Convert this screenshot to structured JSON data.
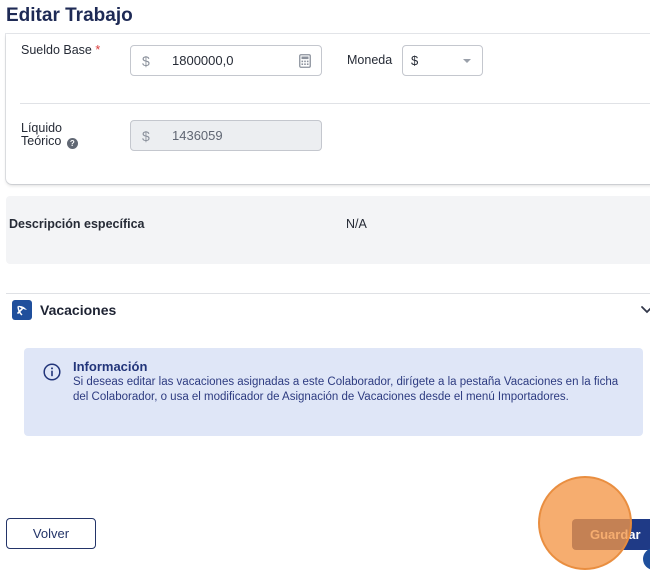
{
  "page": {
    "title": "Editar Trabajo"
  },
  "salary": {
    "base_label": "Sueldo Base",
    "required_mark": "*",
    "base_prefix": "$",
    "base_value": "1800000,0",
    "currency_label": "Moneda",
    "currency_value": "$",
    "net_label_line1": "Líquido",
    "net_label_line2": "Teórico",
    "net_prefix": "$",
    "net_value": "1436059"
  },
  "description": {
    "label": "Descripción específica",
    "value": "N/A"
  },
  "vacations": {
    "title": "Vacaciones",
    "info_title": "Información",
    "info_text": "Si deseas editar las vacaciones asignadas a este Colaborador, dirígete a la pestaña Vacaciones en la ficha del Colaborador, o usa el modificador de Asignación de Vacaciones desde el menú Importadores."
  },
  "footer": {
    "back_label": "Volver",
    "save_label": "Guardar"
  },
  "colors": {
    "primary": "#1f3a86",
    "info_background": "#dfe6f7",
    "click_highlight": "#f49646"
  }
}
